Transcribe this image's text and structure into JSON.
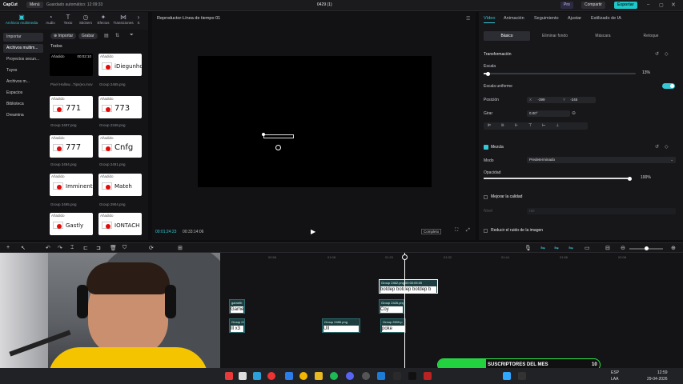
{
  "app": {
    "logo": "CapCut",
    "menu_label": "Menú",
    "saved_status": "Guardado automático: 12:09:33",
    "project_title": "0429 (1)",
    "pro_label": "Pro",
    "share_label": "Compartir",
    "export_label": "Exportar"
  },
  "tools": [
    {
      "label": "Archivos multimedia",
      "icon": "media-icon"
    },
    {
      "label": "Audio",
      "icon": "audio-icon"
    },
    {
      "label": "Texto",
      "icon": "text-icon"
    },
    {
      "label": "Stickers",
      "icon": "sticker-icon"
    },
    {
      "label": "Efectos",
      "icon": "effects-icon"
    },
    {
      "label": "Transiciones",
      "icon": "transitions-icon"
    },
    {
      "label": "S",
      "icon": "more-icon"
    }
  ],
  "leftnav": [
    "Importar",
    "Archivos multim...",
    "Proyectos secun...",
    "Tuyos",
    "Archivos m...",
    "Espacios",
    "Biblioteca",
    "Dreamina"
  ],
  "media": {
    "import_btn": "Importar",
    "record_btn": "Grabar",
    "section": "Todos",
    "added": "Añadido",
    "items": [
      {
        "caption": "Pixel Hallow...Tips(eo.mov",
        "word": "",
        "duration": "00:02:10",
        "dark": true
      },
      {
        "caption": "Group 2465.png",
        "word": "iDiegunhoo",
        "small": true
      },
      {
        "caption": "Group 2497.png",
        "word": "771"
      },
      {
        "caption": "Group 2348.png",
        "word": "773"
      },
      {
        "caption": "Group 2494.png",
        "word": "777"
      },
      {
        "caption": "Group 2491.png",
        "word": "Cnfg"
      },
      {
        "caption": "Group 2495.png",
        "word": "Imminent",
        "small": true
      },
      {
        "caption": "Group 2904.png",
        "word": "Mateh"
      },
      {
        "caption": "",
        "word": "Gastly"
      },
      {
        "caption": "",
        "word": "IONTACH",
        "small": true
      }
    ]
  },
  "player": {
    "title": "Reproductor-Línea de tiempo 01",
    "current_time": "00:01:24:23",
    "total_time": "00:33:14:06",
    "ratio_label": "Completo"
  },
  "right": {
    "tabs": [
      "Vídeo",
      "Animación",
      "Seguimiento",
      "Ajustar",
      "Estilizado de IA"
    ],
    "subtabs": [
      "Básico",
      "Eliminar fondo",
      "Máscara",
      "Retoque"
    ],
    "transform_title": "Transformación",
    "scale_label": "Escala",
    "scale_value": "13%",
    "scale_fraction": 0.03,
    "uniform_label": "Escala uniforme",
    "position_label": "Posición",
    "pos_x_label": "X",
    "pos_x": "-399",
    "pos_y_label": "Y",
    "pos_y": "-245",
    "rotate_label": "Girar",
    "rotate_value": "0.00°",
    "blend_title": "Mezcla",
    "mode_label": "Modo",
    "mode_value": "Predeterminado",
    "opacity_label": "Opacidad",
    "opacity_value": "100%",
    "opacity_fraction": 1.0,
    "improve_label": "Mejorar la calidad",
    "level_label": "Nivel",
    "level_value": "HD",
    "noise_label": "Reducir el ruido de la imagen"
  },
  "timeline": {
    "ticks": [
      "00:56",
      "01:08",
      "01:20",
      "01:32",
      "01:44",
      "01:56",
      "02:08"
    ],
    "clips": [
      {
        "label": "Group 2462.png  00:00:05:00",
        "text": "botdep botdep botdep b"
      },
      {
        "label": "gameth",
        "text": "Game"
      },
      {
        "label": "Group 2426.png",
        "text": "Coy"
      },
      {
        "label": "Group 24",
        "text": "lll x3"
      },
      {
        "label": "Group 2486.png",
        "text": "Ull"
      },
      {
        "label": "Group 2509.p",
        "text": "poke"
      }
    ]
  },
  "overlay": {
    "subs_title": "SUSCRIPTORES DEL MES",
    "subs_count": "10"
  },
  "taskbar": {
    "lang": "ESP",
    "region": "LAA",
    "time": "12:59",
    "date": "29-04-2026"
  }
}
